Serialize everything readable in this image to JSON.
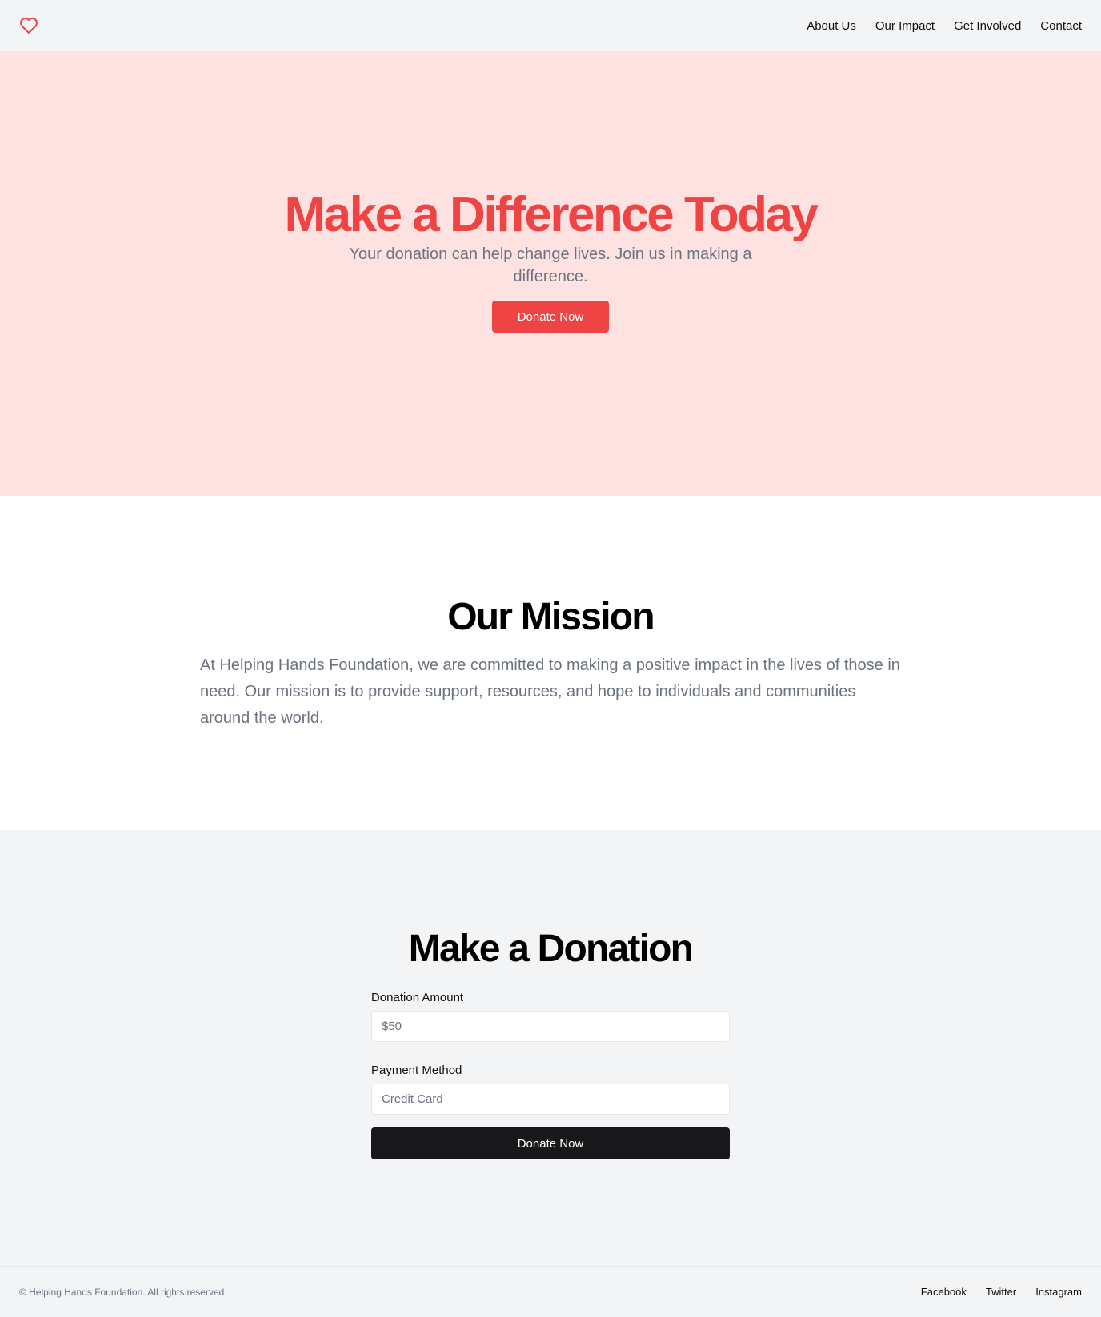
{
  "header": {
    "logo_icon": "heart-icon",
    "nav": [
      "About Us",
      "Our Impact",
      "Get Involved",
      "Contact"
    ]
  },
  "hero": {
    "title": "Make a Difference Today",
    "subtitle": "Your donation can help change lives. Join us in making a difference.",
    "button": "Donate Now"
  },
  "mission": {
    "title": "Our Mission",
    "text": "At Helping Hands Foundation, we are committed to making a positive impact in the lives of those in need. Our mission is to provide support, resources, and hope to individuals and communities around the world."
  },
  "donation": {
    "title": "Make a Donation",
    "amount_label": "Donation Amount",
    "amount_placeholder": "$50",
    "payment_label": "Payment Method",
    "payment_placeholder": "Credit Card",
    "button": "Donate Now"
  },
  "footer": {
    "copyright": "© Helping Hands Foundation. All rights reserved.",
    "links": [
      "Facebook",
      "Twitter",
      "Instagram"
    ]
  },
  "colors": {
    "accent": "#ef4444",
    "hero_bg": "#fee2e2",
    "dark_button": "#18181b"
  }
}
